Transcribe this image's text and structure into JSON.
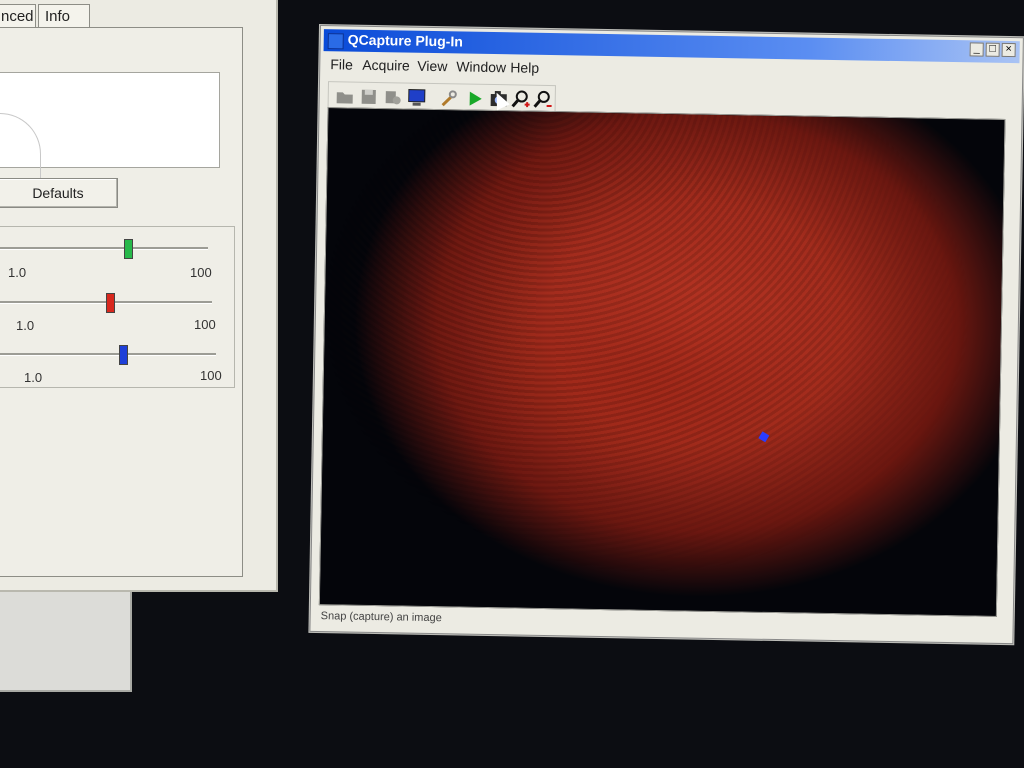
{
  "left_panel": {
    "tabs": [
      {
        "label": "nced"
      },
      {
        "label": "Info"
      }
    ],
    "defaults_button": "Defaults",
    "sliders": [
      {
        "color": "#27b84a",
        "min_label": "1.0",
        "max_label": "100"
      },
      {
        "color": "#d8281e",
        "min_label": "1.0",
        "max_label": "100"
      },
      {
        "color": "#1e3fd8",
        "min_label": "1.0",
        "max_label": "100"
      }
    ]
  },
  "window": {
    "title": "QCapture Plug-In",
    "controls": [
      "_",
      "□",
      "×"
    ],
    "menu": [
      "File",
      "Acquire",
      "View",
      "Window",
      "Help"
    ],
    "toolbar_icons": [
      "open-icon",
      "save-icon",
      "settings-icon",
      "monitor-icon",
      "wrench-icon",
      "play-icon",
      "snap-camera-icon",
      "zoom-in-icon",
      "zoom-out-icon"
    ],
    "status_text": "Snap (capture) an image"
  }
}
